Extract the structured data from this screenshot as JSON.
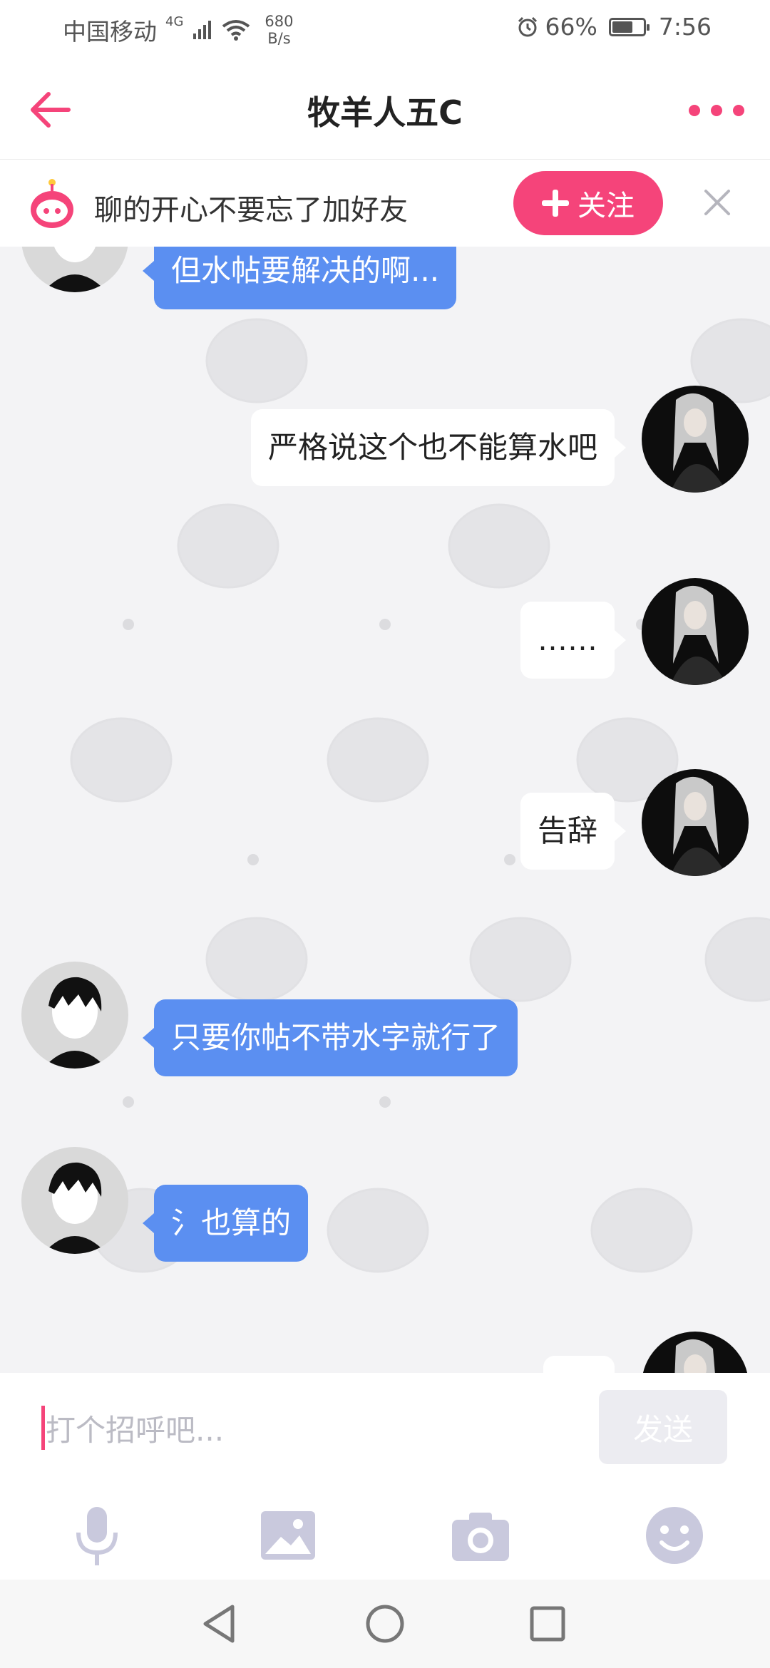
{
  "status_bar": {
    "carrier": "中国移动",
    "network_type": "4G",
    "net_speed_value": "680",
    "net_speed_unit": "B/s",
    "battery_percent": "66%",
    "battery_level": 0.66,
    "time": "7:56"
  },
  "header": {
    "title": "牧羊人五C",
    "accent_color": "#f5447a"
  },
  "banner": {
    "text": "聊的开心不要忘了加好友",
    "follow_label": "关注"
  },
  "messages": [
    {
      "side": "in",
      "text": "但水帖要解决的啊..."
    },
    {
      "side": "out",
      "text": "严格说这个也不能算水吧"
    },
    {
      "side": "out",
      "text": "……"
    },
    {
      "side": "out",
      "text": "告辞"
    },
    {
      "side": "in",
      "text": "只要你帖不带水字就行了"
    },
    {
      "side": "in",
      "text": "氵也算的"
    }
  ],
  "composer": {
    "placeholder": "打个招呼吧...",
    "send_label": "发送"
  },
  "colors": {
    "incoming_bubble": "#5b8ff1",
    "outgoing_bubble": "#ffffff",
    "chat_background": "#f3f3f5"
  }
}
